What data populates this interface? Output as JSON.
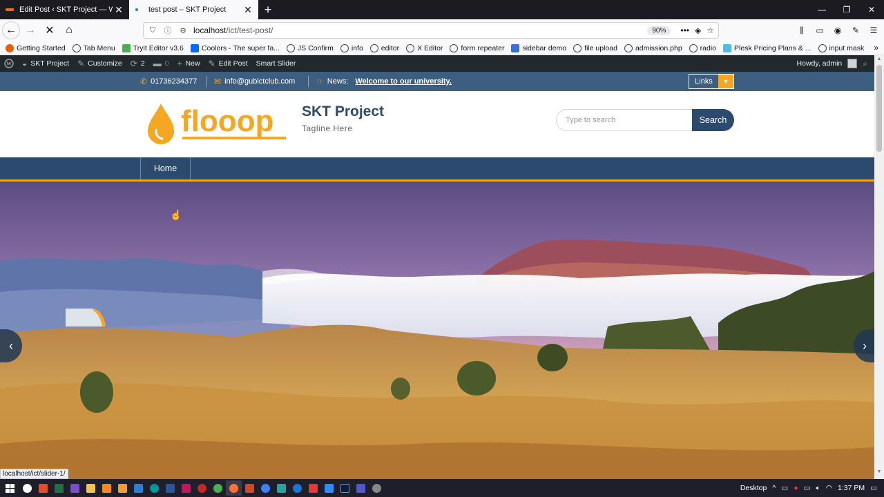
{
  "browser": {
    "tabs": [
      {
        "title": "Edit Post ‹ SKT Project — Word",
        "active": false
      },
      {
        "title": "test post – SKT Project",
        "active": true
      }
    ],
    "new_tab_label": "+",
    "url_host": "localhost",
    "url_path": "/ict/test-post/",
    "zoom": "90%",
    "bookmarks": [
      {
        "label": "Getting Started",
        "icon": "firefox-icon"
      },
      {
        "label": "Tab Menu",
        "icon": "globe-icon"
      },
      {
        "label": "Tryit Editor v3.6",
        "icon": "w3schools-icon"
      },
      {
        "label": "Coolors - The super fa...",
        "icon": "coolors-icon"
      },
      {
        "label": "JS Confirm",
        "icon": "globe-icon"
      },
      {
        "label": "info",
        "icon": "globe-icon"
      },
      {
        "label": "editor",
        "icon": "globe-icon"
      },
      {
        "label": "X Editor",
        "icon": "globe-icon"
      },
      {
        "label": "form repeater",
        "icon": "globe-icon"
      },
      {
        "label": "sidebar demo",
        "icon": "mdb-icon"
      },
      {
        "label": "file upload",
        "icon": "globe-icon"
      },
      {
        "label": "admission.php",
        "icon": "globe-icon"
      },
      {
        "label": "radio",
        "icon": "globe-icon"
      },
      {
        "label": "Plesk Pricing Plans & ...",
        "icon": "plesk-icon"
      },
      {
        "label": "input mask",
        "icon": "globe-icon"
      }
    ],
    "status_url": "localhost/ict/slider-1/"
  },
  "wp_admin_bar": {
    "site_name": "SKT Project",
    "customize": "Customize",
    "updates_count": "2",
    "comments_count": "0",
    "new": "New",
    "edit_post": "Edit Post",
    "smart_slider": "Smart Slider",
    "greeting": "Howdy, admin"
  },
  "topbar": {
    "phone": "01736234377",
    "email": "info@gubictclub.com",
    "news_label": "News:",
    "news_text": "Welcome to our university.",
    "links_button": "Links"
  },
  "header": {
    "logo_text": "flooop",
    "site_title": "SKT Project",
    "tagline": "Tagline Here",
    "search_placeholder": "Type to search",
    "search_button": "Search"
  },
  "menu": {
    "items": [
      {
        "label": "Home"
      }
    ]
  },
  "taskbar": {
    "desktop_label": "Desktop",
    "clock": "1:37 PM"
  },
  "colors": {
    "brand_blue": "#2c4a6d",
    "topbar_blue": "#3e5e80",
    "accent_orange": "#f5a623",
    "wp_bar": "#23282d"
  }
}
